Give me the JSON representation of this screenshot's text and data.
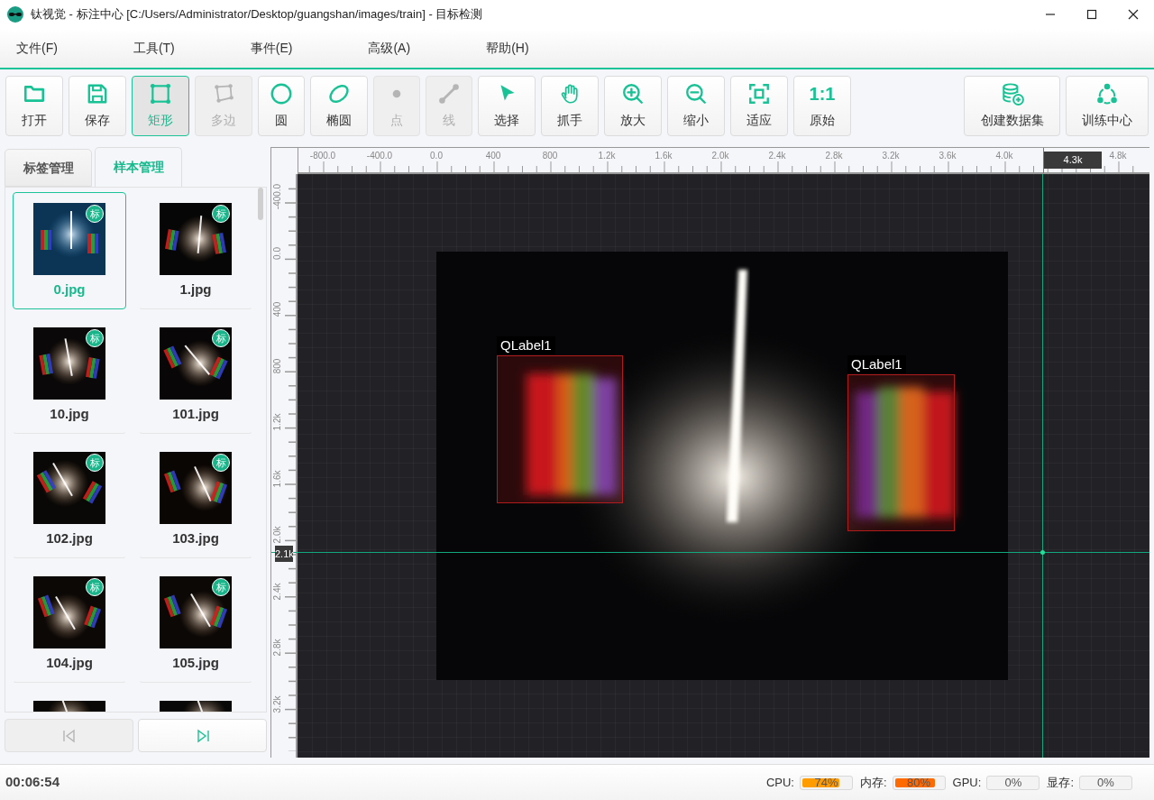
{
  "window": {
    "title": "钛视觉 - 标注中心 [C:/Users/Administrator/Desktop/guangshan/images/train] - 目标检测"
  },
  "menu": [
    "文件(F)",
    "工具(T)",
    "事件(E)",
    "高级(A)",
    "帮助(H)"
  ],
  "toolbar": [
    {
      "label": "打开",
      "kind": "folder",
      "selected": false,
      "disabled": false
    },
    {
      "label": "保存",
      "kind": "save",
      "selected": false,
      "disabled": false
    },
    {
      "label": "矩形",
      "kind": "rectangle",
      "selected": true,
      "disabled": false
    },
    {
      "label": "多边",
      "kind": "polygon",
      "selected": false,
      "disabled": true
    },
    {
      "label": "圆",
      "kind": "circle",
      "selected": false,
      "disabled": false
    },
    {
      "label": "椭圆",
      "kind": "ellipse",
      "selected": false,
      "disabled": false
    },
    {
      "label": "点",
      "kind": "point",
      "selected": false,
      "disabled": true
    },
    {
      "label": "线",
      "kind": "line",
      "selected": false,
      "disabled": true
    },
    {
      "label": "选择",
      "kind": "pointer",
      "selected": false,
      "disabled": false
    },
    {
      "label": "抓手",
      "kind": "hand",
      "selected": false,
      "disabled": false
    },
    {
      "label": "放大",
      "kind": "zoom-in",
      "selected": false,
      "disabled": false
    },
    {
      "label": "缩小",
      "kind": "zoom-out",
      "selected": false,
      "disabled": false
    },
    {
      "label": "适应",
      "kind": "fit",
      "selected": false,
      "disabled": false
    },
    {
      "label": "原始",
      "kind": "glyph",
      "glyph": "1:1",
      "selected": false,
      "disabled": false
    }
  ],
  "toolbar_right": [
    {
      "label": "创建数据集",
      "kind": "database-add"
    },
    {
      "label": "训练中心",
      "kind": "cycle"
    }
  ],
  "panel_tabs": [
    {
      "label": "标签管理",
      "selected": false
    },
    {
      "label": "样本管理",
      "selected": true
    }
  ],
  "samples": [
    {
      "name": "0.jpg",
      "badge": "标",
      "selected": true
    },
    {
      "name": "1.jpg",
      "badge": "标",
      "selected": false
    },
    {
      "name": "10.jpg",
      "badge": "标",
      "selected": false
    },
    {
      "name": "101.jpg",
      "badge": "标",
      "selected": false
    },
    {
      "name": "102.jpg",
      "badge": "标",
      "selected": false
    },
    {
      "name": "103.jpg",
      "badge": "标",
      "selected": false
    },
    {
      "name": "104.jpg",
      "badge": "标",
      "selected": false
    },
    {
      "name": "105.jpg",
      "badge": "标",
      "selected": false
    },
    {
      "selected": false
    },
    {
      "selected": false
    }
  ],
  "nav_buttons": [
    {
      "kind": "previous",
      "disabled": true
    },
    {
      "kind": "next",
      "disabled": false
    }
  ],
  "rulers": {
    "horizontal": [
      "-800.0",
      "-400.0",
      "0.0",
      "400",
      "800",
      "1.2k",
      "1.6k",
      "2.0k",
      "2.4k",
      "2.8k",
      "3.2k",
      "3.6k",
      "4.0k",
      "4.8k"
    ],
    "vertical": [
      "-400.0",
      "0.0",
      "400",
      "800",
      "1.2k",
      "1.6k",
      "2.0k",
      "2.4k",
      "2.8k",
      "3.2k"
    ]
  },
  "cursor": {
    "x_reading": "4.3k",
    "y_reading": "2.1k"
  },
  "annotations": [
    {
      "label": "QLabel1"
    },
    {
      "label": "QLabel1"
    }
  ],
  "status_bar": {
    "time": "00:06:54",
    "meters": [
      {
        "label": "CPU:",
        "reading": "74%",
        "level": 0.74
      },
      {
        "label": "内存:",
        "reading": "80%",
        "level": 0.8
      },
      {
        "label": "GPU:",
        "reading": "0%",
        "level": 0
      },
      {
        "label": "显存:",
        "reading": "0%",
        "level": 0
      }
    ]
  }
}
